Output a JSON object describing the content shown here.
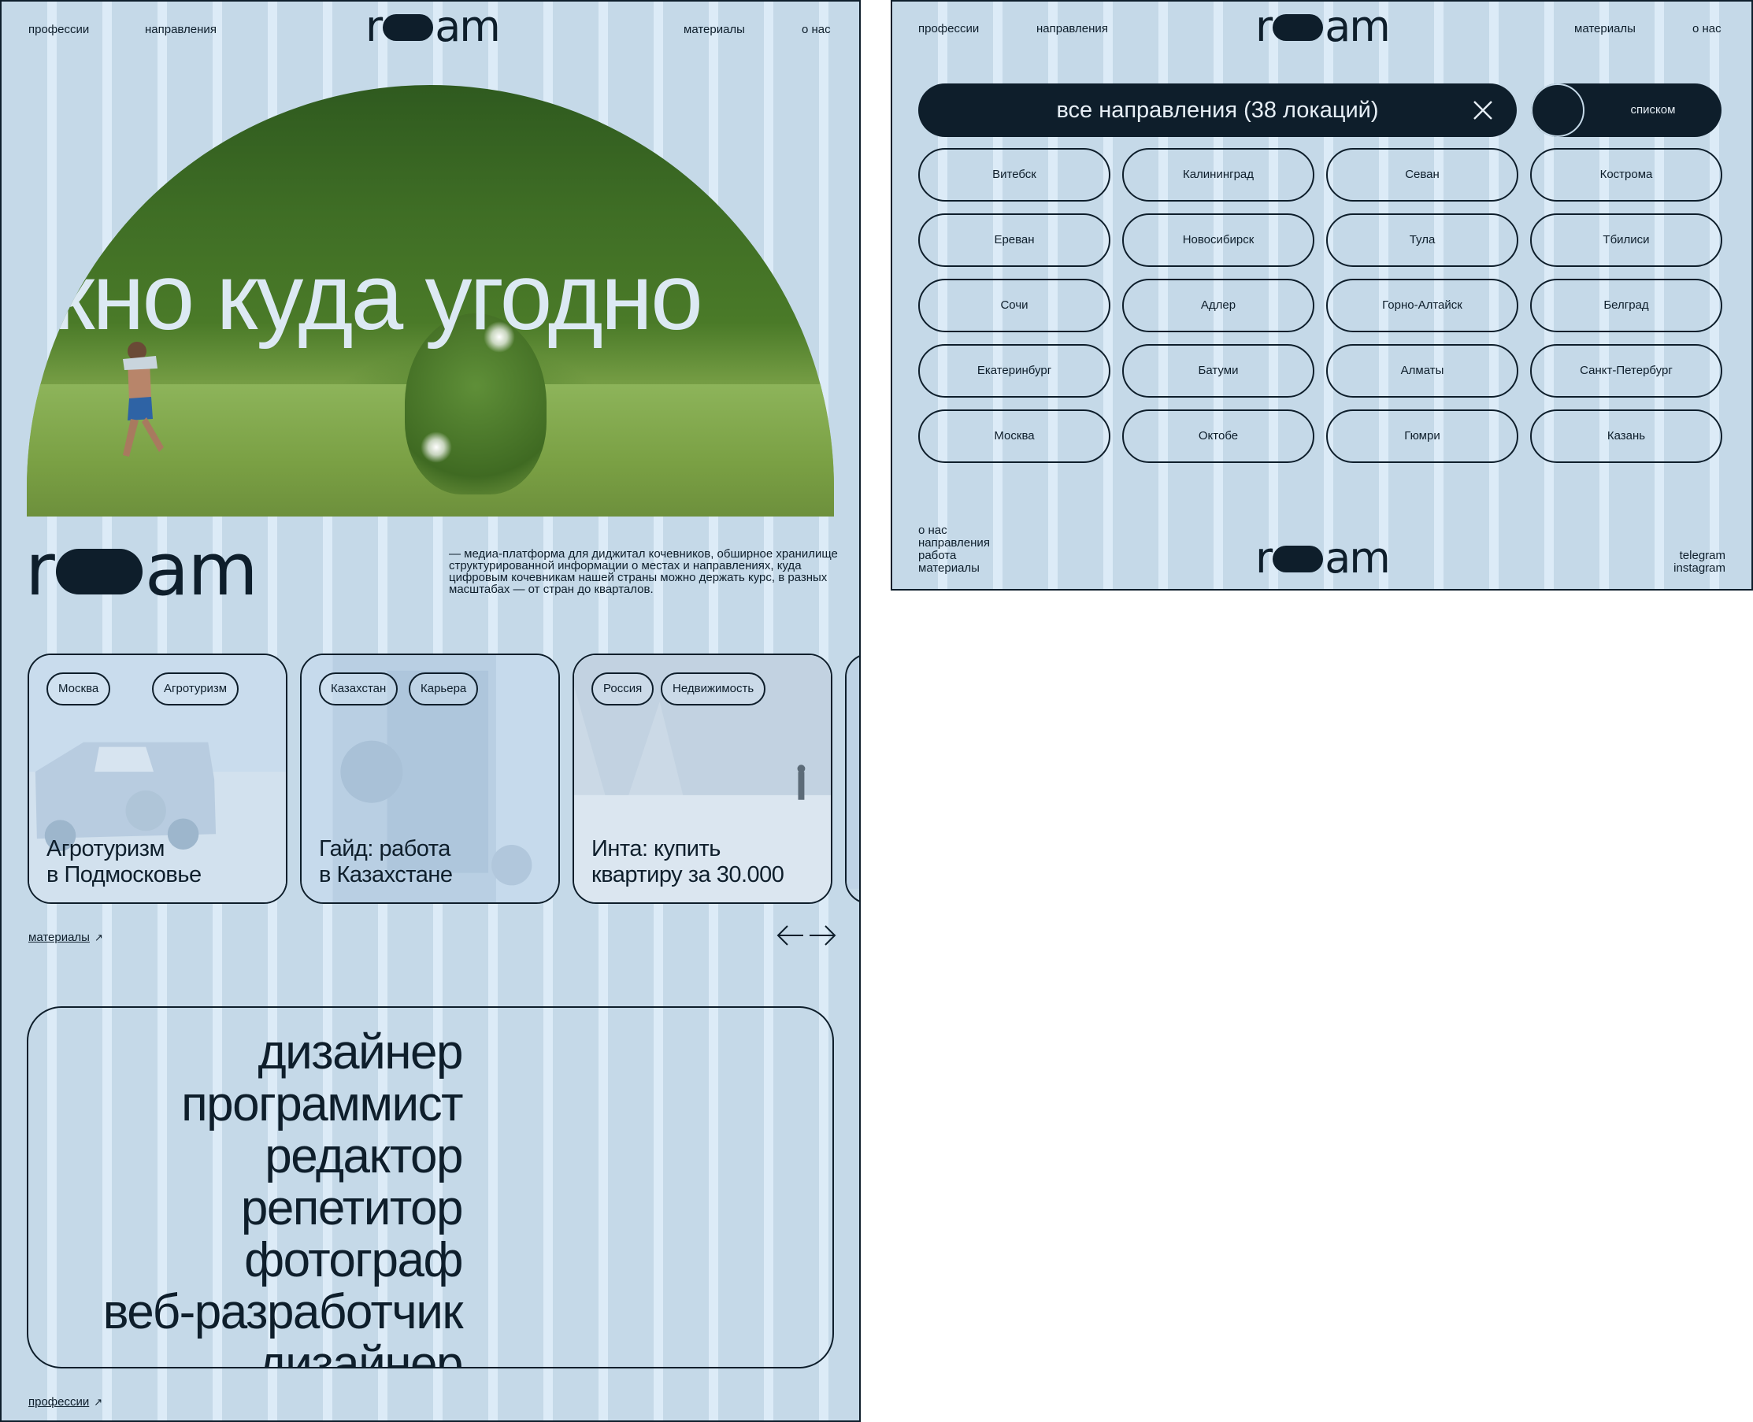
{
  "left": {
    "nav": {
      "professions": "профессии",
      "directions": "направления",
      "materials": "материалы",
      "about": "о нас"
    },
    "logo": {
      "r": "r",
      "am": "am"
    },
    "hero": {
      "title": "окно куда угодно"
    },
    "description": "— медиа-платформа для диджитал кочевников, обширное хранилище структурированной информации о местах и направлениях, куда цифровым кочевникам нашей страны можно держать курс, в разных масштабах — от стран до кварталов.",
    "cards": [
      {
        "tags": [
          "Москва",
          "Агротуризм"
        ],
        "title_line1": "Агротуризм",
        "title_line2": "в Подмосковье"
      },
      {
        "tags": [
          "Казахстан",
          "Карьера"
        ],
        "title_line1": "Гайд: работа",
        "title_line2": "в Казахстане"
      },
      {
        "tags": [
          "Россия",
          "Недвижимость"
        ],
        "title_line1": "Инта: купить",
        "title_line2": "квартиру за 30.000"
      }
    ],
    "materials_link": "материалы",
    "link_arrow": "↗",
    "professions": [
      "дизайнер",
      "программист",
      "редактор",
      "репетитор",
      "фотограф",
      "веб-разработчик",
      "дизайнер"
    ],
    "professions_link": "профессии"
  },
  "right": {
    "nav": {
      "professions": "профессии",
      "directions": "направления",
      "materials": "материалы",
      "about": "о нас"
    },
    "search": {
      "label": "все направления (38 локаций)"
    },
    "toggle_label": "списком",
    "cities": [
      "Витебск",
      "Калининград",
      "Севан",
      "Кострома",
      "Ереван",
      "Новосибирск",
      "Тула",
      "Тбилиси",
      "Сочи",
      "Адлер",
      "Горно-Алтайск",
      "Белград",
      "Екатеринбург",
      "Батуми",
      "Алматы",
      "Санкт-Петербург",
      "Москва",
      "Октобе",
      "Гюмри",
      "Казань"
    ],
    "footer": {
      "left": [
        "о нас",
        "направления",
        "работа",
        "материалы"
      ],
      "right": [
        "telegram",
        "instagram"
      ]
    }
  },
  "colors": {
    "ink": "#0e1e2b",
    "stripe_dark": "#c5d9e8",
    "stripe_light": "#dcebf7",
    "accent_text": "#e6eef5"
  }
}
